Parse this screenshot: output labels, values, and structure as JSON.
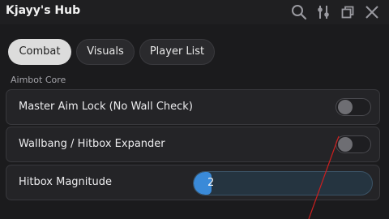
{
  "window": {
    "title": "Kjayy's Hub",
    "icons": [
      "search-icon",
      "sliders-icon",
      "restore-icon",
      "close-icon"
    ]
  },
  "tabs": [
    {
      "label": "Combat",
      "active": true
    },
    {
      "label": "Visuals",
      "active": false
    },
    {
      "label": "Player List",
      "active": false
    }
  ],
  "section": {
    "title": "Aimbot Core"
  },
  "toggles": [
    {
      "label": "Master Aim Lock (No Wall Check)",
      "on": false
    },
    {
      "label": "Wallbang / Hitbox Expander",
      "on": false
    }
  ],
  "slider": {
    "label": "Hitbox Magnitude",
    "value": "2",
    "fill_fraction": 0.1
  },
  "colors": {
    "background": "#1b1b1d",
    "accent": "#3a8ad8",
    "slider_track": "#253440",
    "annotation_line": "#cc1f1f"
  }
}
